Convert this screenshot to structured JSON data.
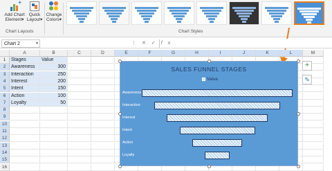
{
  "ribbon": {
    "add_chart": "Add Chart Element",
    "add_chart_l1": "Add Chart",
    "add_chart_l2": "Element",
    "quick_l1": "Quick",
    "quick_l2": "Layout",
    "colors_l1": "Change",
    "colors_l2": "Colors",
    "group_chart_layouts": "Chart Layouts",
    "group_chart_styles": "Chart Styles",
    "selected_style_index": 8
  },
  "formula_bar": {
    "name_box": "Chart 2",
    "fx": "fx"
  },
  "sheet": {
    "columns": [
      "A",
      "B",
      "C",
      "D",
      "E",
      "F",
      "G",
      "H",
      "I",
      "J",
      "K",
      "L",
      "M"
    ],
    "rows": [
      "1",
      "2",
      "3",
      "4",
      "5",
      "6",
      "7",
      "8",
      "9",
      "10",
      "11",
      "12",
      "13",
      "14",
      "15",
      "16"
    ],
    "header": [
      "Stages",
      "Value"
    ],
    "data": [
      [
        "Awareness",
        "300"
      ],
      [
        "Interaction",
        "250"
      ],
      [
        "Interest",
        "200"
      ],
      [
        "Intent",
        "150"
      ],
      [
        "Action",
        "100"
      ],
      [
        "Loyalty",
        "50"
      ]
    ]
  },
  "chart_data": {
    "type": "bar",
    "title": "SALES FUNNEL STAGES",
    "categories": [
      "Awareness",
      "Interaction",
      "Interest",
      "Intent",
      "Action",
      "Loyalty"
    ],
    "series": [
      {
        "name": "Value",
        "values": [
          300,
          250,
          200,
          150,
          100,
          50
        ]
      }
    ],
    "orientation": "horizontal-funnel",
    "legend": "top",
    "colors": {
      "background": "#5b9bd5",
      "bar_fill": "#bdd7ee",
      "bar_border": "#1f3864"
    }
  },
  "side_buttons": {
    "add": "+",
    "style": "✎"
  },
  "accent": {
    "selection": "#e67e22"
  }
}
